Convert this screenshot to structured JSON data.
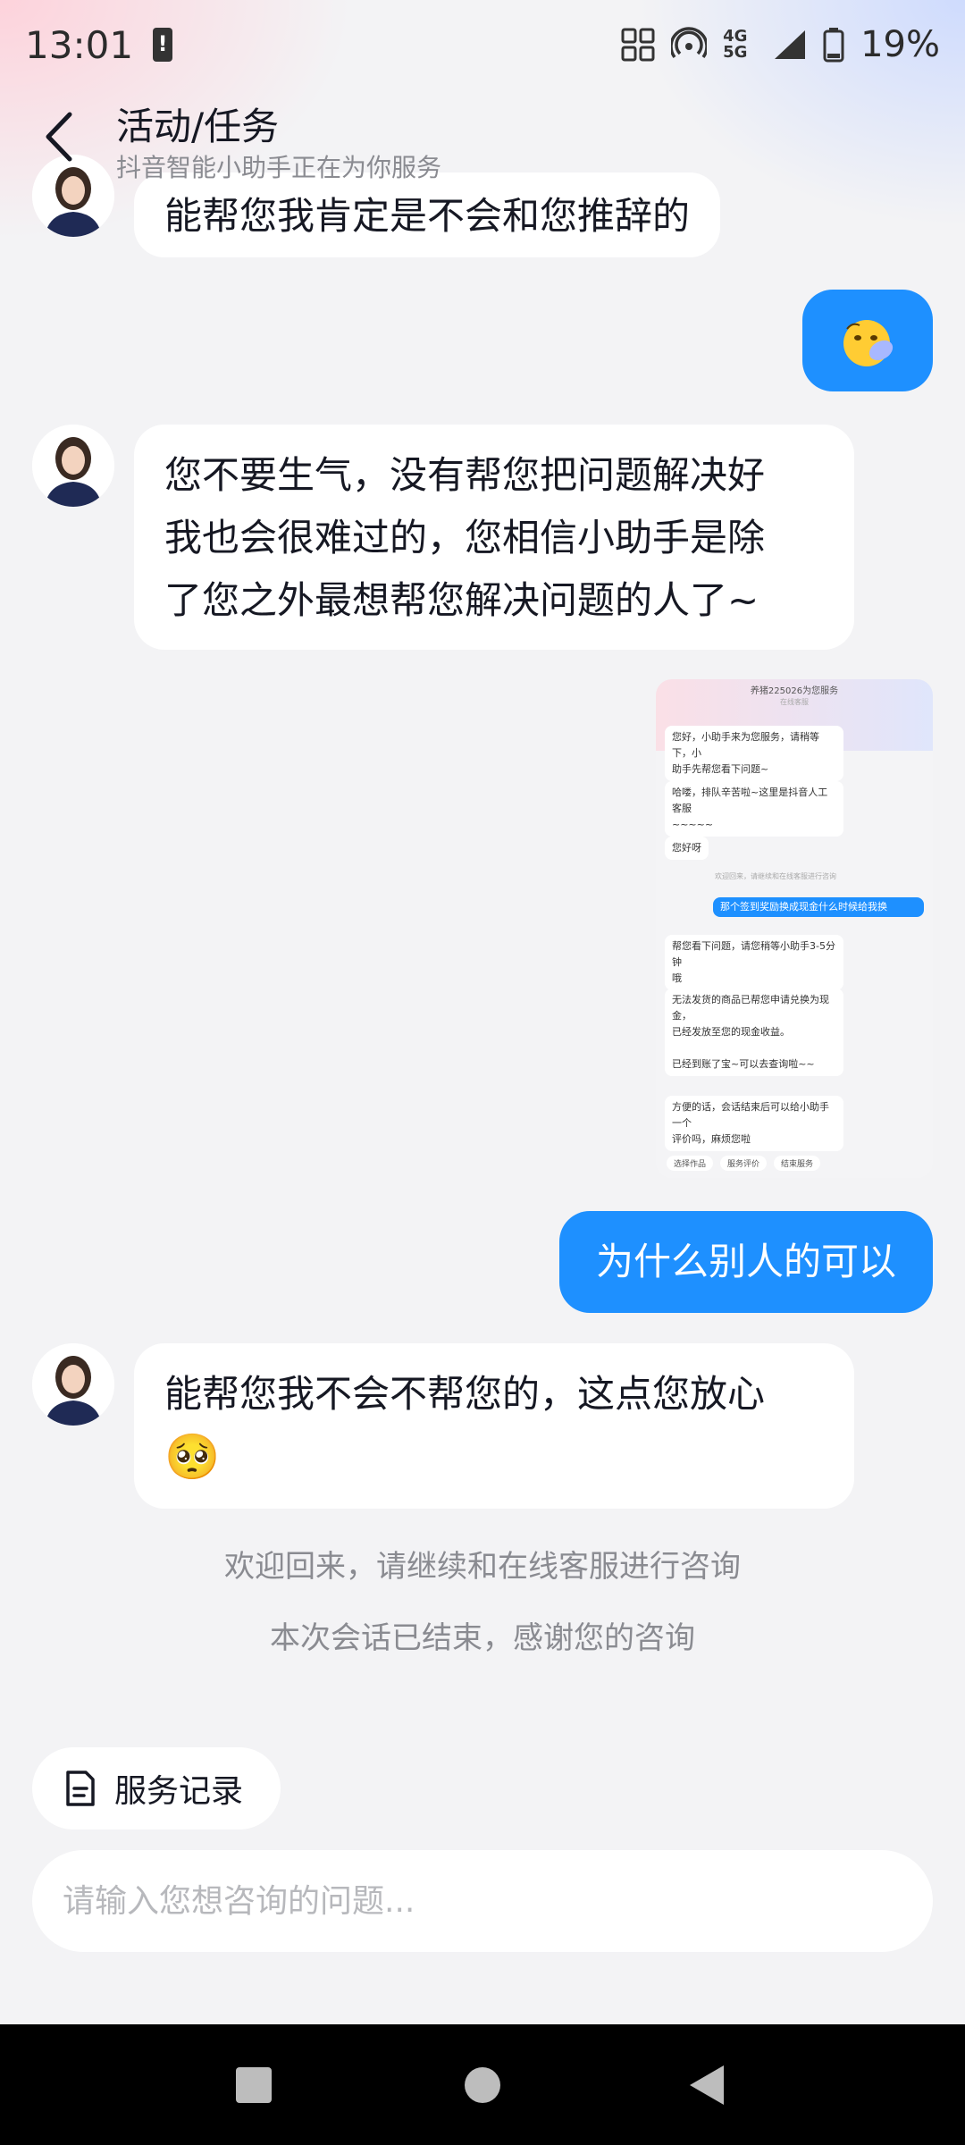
{
  "status_bar": {
    "time": "13:01",
    "network": "4G 5G",
    "battery": "19%",
    "icons": [
      "battery-alert-icon",
      "hd-icon",
      "hotspot-icon",
      "signal-icon",
      "battery-icon"
    ]
  },
  "header": {
    "title": "活动/任务",
    "subtitle": "抖音智能小助手正在为你服务"
  },
  "colors": {
    "accent": "#1e90ff",
    "bubble_bg": "#ffffff",
    "page_bg": "#f3f3f5",
    "muted_text": "#8a8b91"
  },
  "messages": {
    "m1": "能帮您我肯定是不会和您推辞的",
    "m2_emoji": "emoji-sticker",
    "m3_lines": [
      "您不要生气，没有帮您把问题解决好",
      "我也会很难过的，您相信小助手是除",
      "了您之外最想帮您解决问题的人了~"
    ],
    "m5": "为什么别人的可以",
    "m6_line1": "能帮您我不会不帮您的，这点您放心",
    "m6_emoji": "🥺"
  },
  "shot": {
    "title": "养猪225026为您服务",
    "subtitle": "在线客服",
    "b1": "您好，小助手来为您服务，请稍等下，小\n助手先帮您看下问题~",
    "b2": "哈喽，排队辛苦啦~这里是抖音人工客服\n~~~~~",
    "b3": "您好呀",
    "sys": "欢迎回来，请继续和在线客服进行咨询",
    "blue": "那个签到奖励换成现金什么时候给我换",
    "b4": "帮您看下问题，请您稍等小助手3-5分钟\n哦",
    "b5": "无法发货的商品已帮您申请兑换为现金，\n已经发放至您的现金收益。\n\n已经到账了宝~可以去查询啦~~",
    "b6": "方便的话，会话结束后可以给小助手一个\n评价吗，麻烦您啦",
    "chips": [
      "选择作品",
      "服务评价",
      "结束服务"
    ]
  },
  "system": {
    "welcome": "欢迎回来，请继续和在线客服进行咨询",
    "ended": "本次会话已结束，感谢您的咨询"
  },
  "service_button": {
    "label": "服务记录",
    "icon": "document-icon"
  },
  "input": {
    "placeholder": "请输入您想咨询的问题...",
    "value": ""
  },
  "nav": {
    "icons": [
      "recents-square-icon",
      "home-circle-icon",
      "back-triangle-icon"
    ]
  }
}
